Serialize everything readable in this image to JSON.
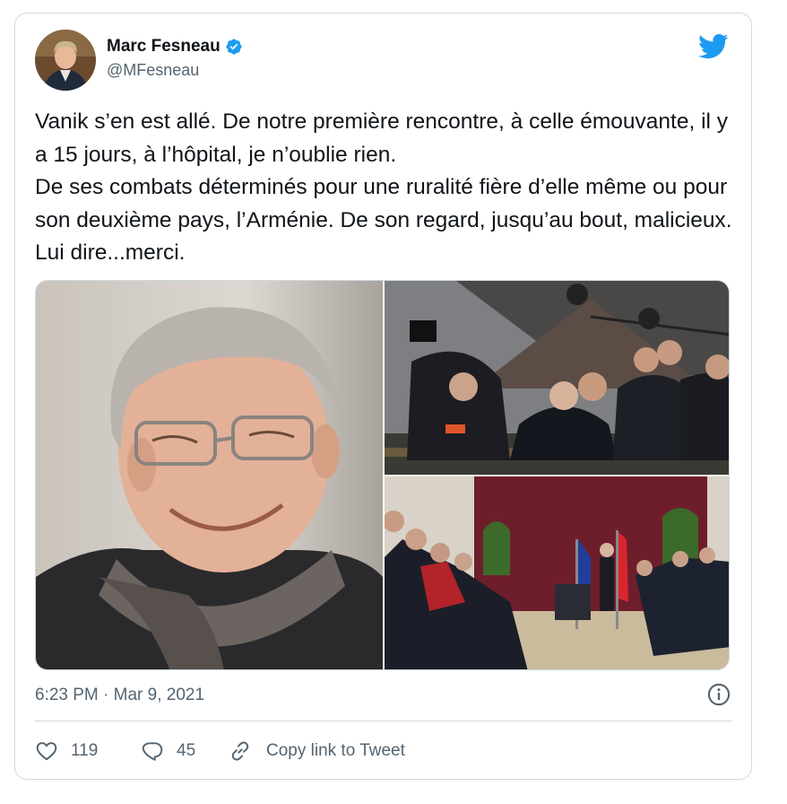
{
  "author": {
    "display_name": "Marc Fesneau",
    "handle": "@MFesneau",
    "verified": true
  },
  "icons": {
    "avatar": "avatar",
    "verified": "verified-badge-icon",
    "brand": "twitter-bird-icon",
    "info": "info-icon",
    "like": "heart-icon",
    "reply": "reply-bubble-icon",
    "copy": "link-icon"
  },
  "tweet": {
    "text": "Vanik s’en est allé. De notre première rencontre, à celle émouvante, il y a 15 jours, à l’hôpital, je n’oublie rien.\nDe ses combats déterminés pour une ruralité fière d’elle même ou pour son deuxième pays, l’Arménie. De son regard, jusqu’au bout, malicieux. Lui dire...merci.",
    "time": "6:23 PM",
    "separator": " · ",
    "date": "Mar 9, 2021"
  },
  "actions": {
    "likes": "119",
    "replies": "45",
    "copy_label": "Copy link to Tweet"
  },
  "colors": {
    "brand": "#1d9bf0",
    "text": "#0f1419",
    "muted": "#536471",
    "border": "#cfd9de"
  }
}
